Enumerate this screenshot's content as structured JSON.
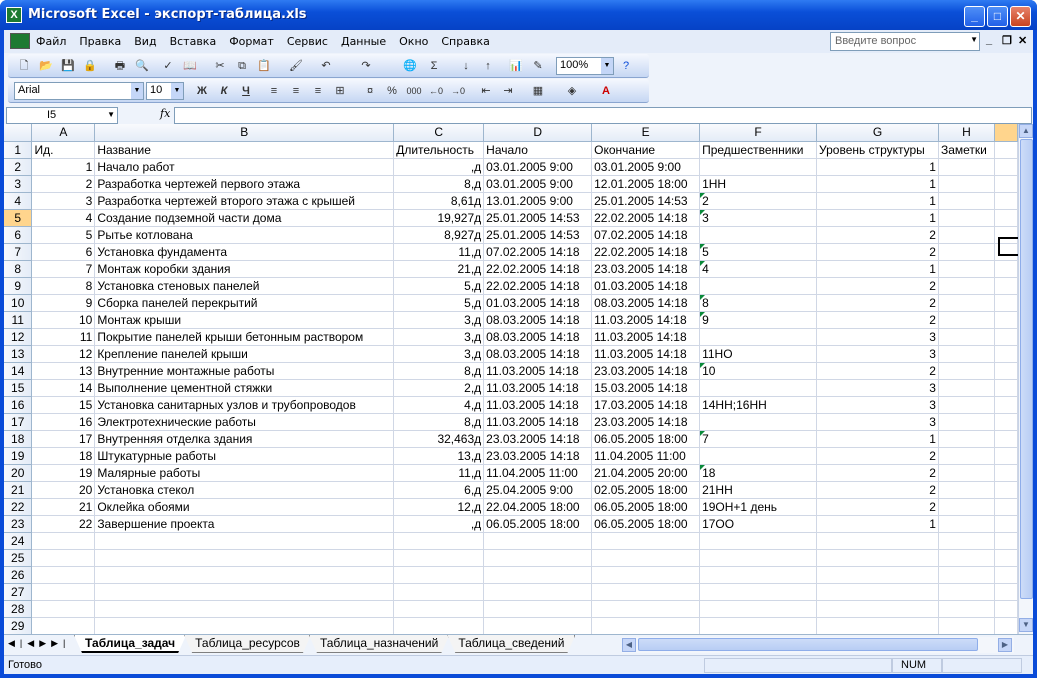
{
  "window": {
    "title": "Microsoft Excel - экспорт-таблица.xls"
  },
  "menu": {
    "items": [
      "Файл",
      "Правка",
      "Вид",
      "Вставка",
      "Формат",
      "Сервис",
      "Данные",
      "Окно",
      "Справка"
    ],
    "help_placeholder": "Введите вопрос"
  },
  "toolbar": {
    "zoom": "100%",
    "font": "Arial",
    "size": "10",
    "bold": "Ж",
    "italic": "К",
    "underline": "Ч",
    "percent": "%",
    "thousands": "000"
  },
  "formula_bar": {
    "name_box": "I5",
    "fx": "fx",
    "content": ""
  },
  "columns": [
    "A",
    "B",
    "C",
    "D",
    "E",
    "F",
    "G",
    "H"
  ],
  "headers": [
    "Ид.",
    "Название",
    "Длительность",
    "Начало",
    "Окончание",
    "Предшественники",
    "Уровень структуры",
    "Заметки"
  ],
  "rows": [
    [
      "1",
      "Начало работ",
      ",д",
      "03.01.2005 9:00",
      "03.01.2005 9:00",
      "",
      "1",
      ""
    ],
    [
      "2",
      "Разработка чертежей первого этажа",
      "8,д",
      "03.01.2005 9:00",
      "12.01.2005 18:00",
      "1НН",
      "1",
      ""
    ],
    [
      "3",
      "Разработка чертежей второго этажа с крышей",
      "8,61д",
      "13.01.2005 9:00",
      "25.01.2005 14:53",
      "2",
      "1",
      ""
    ],
    [
      "4",
      "Создание подземной части дома",
      "19,927д",
      "25.01.2005 14:53",
      "22.02.2005 14:18",
      "3",
      "1",
      ""
    ],
    [
      "5",
      "Рытье котлована",
      "8,927д",
      "25.01.2005 14:53",
      "07.02.2005 14:18",
      "",
      "2",
      ""
    ],
    [
      "6",
      "Установка фундамента",
      "11,д",
      "07.02.2005 14:18",
      "22.02.2005 14:18",
      "5",
      "2",
      ""
    ],
    [
      "7",
      "Монтаж коробки здания",
      "21,д",
      "22.02.2005 14:18",
      "23.03.2005 14:18",
      "4",
      "1",
      ""
    ],
    [
      "8",
      "Установка стеновых панелей",
      "5,д",
      "22.02.2005 14:18",
      "01.03.2005 14:18",
      "",
      "2",
      ""
    ],
    [
      "9",
      "Сборка панелей перекрытий",
      "5,д",
      "01.03.2005 14:18",
      "08.03.2005 14:18",
      "8",
      "2",
      ""
    ],
    [
      "10",
      "Монтаж крыши",
      "3,д",
      "08.03.2005 14:18",
      "11.03.2005 14:18",
      "9",
      "2",
      ""
    ],
    [
      "11",
      "Покрытие панелей крыши бетонным раствором",
      "3,д",
      "08.03.2005 14:18",
      "11.03.2005 14:18",
      "",
      "3",
      ""
    ],
    [
      "12",
      "Крепление панелей крыши",
      "3,д",
      "08.03.2005 14:18",
      "11.03.2005 14:18",
      "11НО",
      "3",
      ""
    ],
    [
      "13",
      "Внутренние монтажные работы",
      "8,д",
      "11.03.2005 14:18",
      "23.03.2005 14:18",
      "10",
      "2",
      ""
    ],
    [
      "14",
      "Выполнение цементной стяжки",
      "2,д",
      "11.03.2005 14:18",
      "15.03.2005 14:18",
      "",
      "3",
      ""
    ],
    [
      "15",
      "Установка санитарных узлов и трубопроводов",
      "4,д",
      "11.03.2005 14:18",
      "17.03.2005 14:18",
      "14НН;16НН",
      "3",
      ""
    ],
    [
      "16",
      "Электротехнические работы",
      "8,д",
      "11.03.2005 14:18",
      "23.03.2005 14:18",
      "",
      "3",
      ""
    ],
    [
      "17",
      "Внутренняя отделка здания",
      "32,463д",
      "23.03.2005 14:18",
      "06.05.2005 18:00",
      "7",
      "1",
      ""
    ],
    [
      "18",
      "Штукатурные работы",
      "13,д",
      "23.03.2005 14:18",
      "11.04.2005 11:00",
      "",
      "2",
      ""
    ],
    [
      "19",
      "Малярные работы",
      "11,д",
      "11.04.2005 11:00",
      "21.04.2005 20:00",
      "18",
      "2",
      ""
    ],
    [
      "20",
      "Установка стекол",
      "6,д",
      "25.04.2005 9:00",
      "02.05.2005 18:00",
      "21НН",
      "2",
      ""
    ],
    [
      "21",
      "Оклейка обоями",
      "12,д",
      "22.04.2005 18:00",
      "06.05.2005 18:00",
      "19ОН+1 день",
      "2",
      ""
    ],
    [
      "22",
      "Завершение проекта",
      ",д",
      "06.05.2005 18:00",
      "06.05.2005 18:00",
      "17ОО",
      "1",
      ""
    ]
  ],
  "empty_rows": [
    "24",
    "25",
    "26",
    "27",
    "28",
    "29"
  ],
  "tabs": [
    "Таблица_задач",
    "Таблица_ресурсов",
    "Таблица_назначений",
    "Таблица_сведений"
  ],
  "status": {
    "text": "Готово",
    "num": "NUM"
  }
}
